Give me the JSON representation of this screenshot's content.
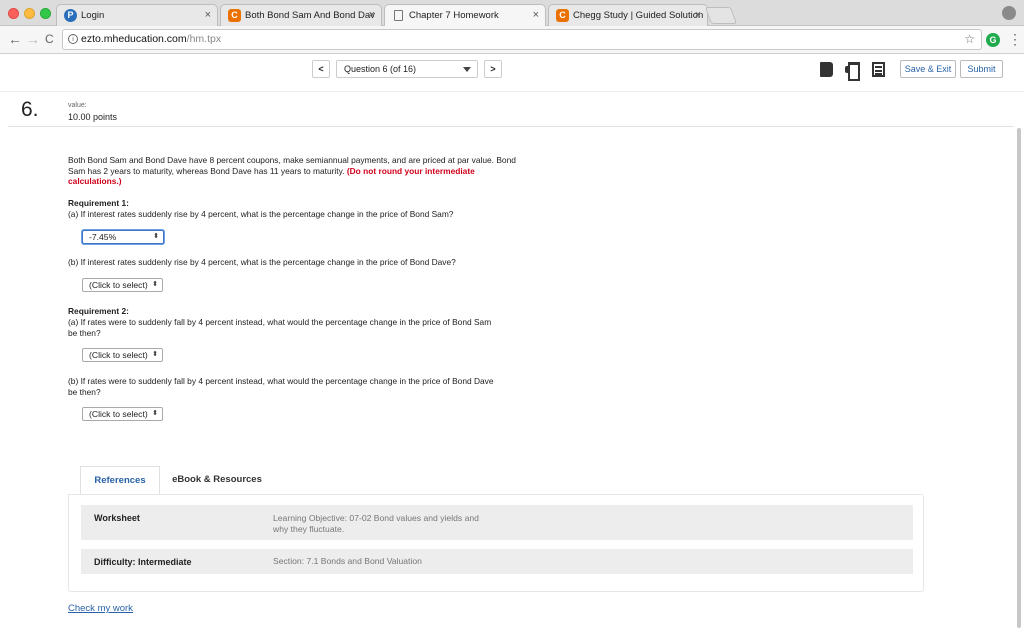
{
  "browser": {
    "tabs": [
      {
        "title": "Login",
        "icon": "pearson-icon",
        "active": false
      },
      {
        "title": "Both Bond Sam And Bond Dav",
        "icon": "chegg-icon",
        "active": false
      },
      {
        "title": "Chapter 7 Homework",
        "icon": "document-icon",
        "active": true
      },
      {
        "title": "Chegg Study | Guided Solution",
        "icon": "chegg-icon",
        "active": false
      }
    ],
    "tab_close": "×",
    "url_host": "ezto.mheducation.com",
    "url_path": "/hm.tpx",
    "back": "←",
    "forward": "→",
    "reload": "C",
    "star": "☆",
    "menu": "⋮",
    "extension_letter": "G"
  },
  "toolbar": {
    "prev": "<",
    "next": ">",
    "question_selector": "Question 6 (of 16)",
    "save_exit": "Save & Exit",
    "submit": "Submit"
  },
  "question": {
    "number": "6.",
    "value_label": "value:",
    "points": "10.00 points",
    "intro_text": "Both Bond Sam and Bond Dave have 8 percent coupons, make semiannual payments, and are priced at par value. Bond Sam has 2 years to maturity, whereas Bond Dave has 11 years to maturity.",
    "intro_warning": "(Do not round your intermediate calculations.)",
    "req1_title": "Requirement 1:",
    "req1_a": "(a) If interest rates suddenly rise by 4 percent, what is the percentage change in the price of Bond Sam?",
    "req1_a_answer": "-7.45%",
    "req1_b": "(b) If interest rates suddenly rise by 4 percent, what is the percentage change in the price of Bond Dave?",
    "req1_b_answer": "(Click to select)",
    "req2_title": "Requirement 2:",
    "req2_a": "(a) If rates were to suddenly fall by 4 percent instead, what would the percentage change in the price of Bond Sam be then?",
    "req2_a_answer": "(Click to select)",
    "req2_b": "(b) If rates were to suddenly fall by 4 percent instead, what would the percentage change in the price of Bond Dave be then?",
    "req2_b_answer": "(Click to select)",
    "select_arrow": "⬍"
  },
  "references": {
    "tabs": [
      "References",
      "eBook & Resources"
    ],
    "rows": [
      {
        "key": "Worksheet",
        "value": "Learning Objective: 07-02 Bond values and yields and why they fluctuate."
      },
      {
        "key": "Difficulty: Intermediate",
        "value": "Section: 7.1 Bonds and Bond Valuation"
      }
    ]
  },
  "check_my_work": "Check my work",
  "colors": {
    "link_blue": "#2962a8",
    "warning_red": "#d0021b",
    "chegg_orange": "#eb7100"
  }
}
